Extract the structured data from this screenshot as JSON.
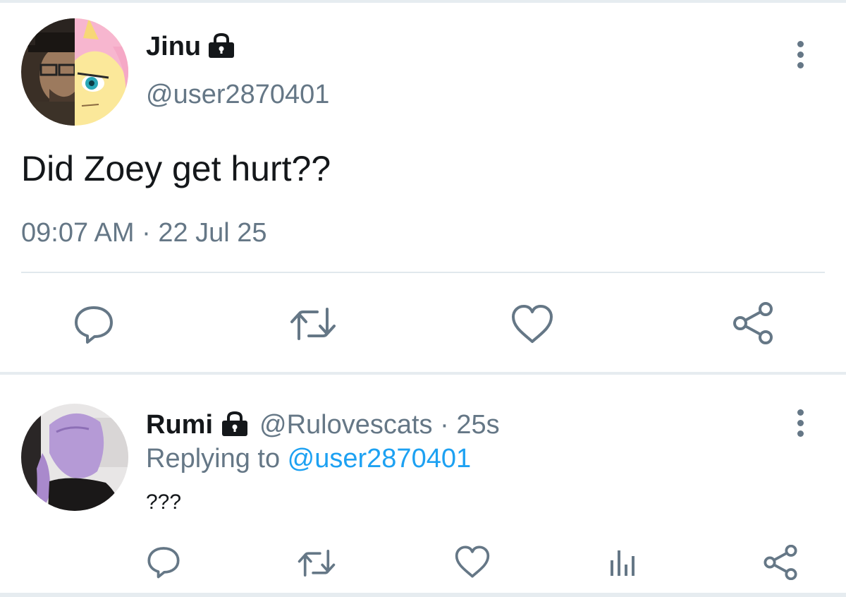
{
  "main_tweet": {
    "display_name": "Jinu",
    "handle": "@user2870401",
    "text": "Did Zoey get hurt??",
    "timestamp": "09:07 AM · 22 Jul 25",
    "locked": true,
    "actions": [
      "reply-icon",
      "retweet-icon",
      "like-icon",
      "share-icon"
    ]
  },
  "reply_tweet": {
    "display_name": "Rumi",
    "meta": "@Rulovescats · 25s",
    "replying_prefix": "Replying to ",
    "replying_mention": "@user2870401",
    "text": "???",
    "locked": true,
    "actions": [
      "reply-icon",
      "retweet-icon",
      "like-icon",
      "analytics-icon",
      "share-icon"
    ]
  },
  "colors": {
    "text": "#14171a",
    "secondary": "#657786",
    "link": "#1da1f2",
    "divider": "#e1e8ed"
  }
}
